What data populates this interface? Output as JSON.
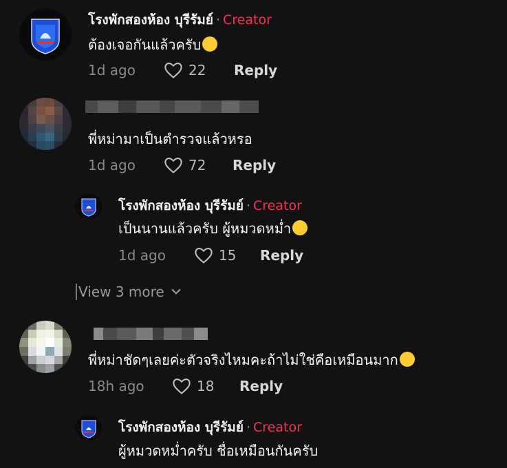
{
  "comments": [
    {
      "username": "โรงพักสองห้อง บุรีรัมย์",
      "separator": "·",
      "badge": "Creator",
      "text": "ต้องเจอกันแล้วครับ",
      "emoji": "laughing-rolling-emoji",
      "time": "1d ago",
      "likes": "22",
      "reply_label": "Reply"
    },
    {
      "username": "",
      "text": "พี่หม่ามาเป็นตำรวจแล้วหรอ",
      "time": "1d ago",
      "likes": "72",
      "reply_label": "Reply"
    },
    {
      "username": "โรงพักสองห้อง บุรีรัมย์",
      "separator": "·",
      "badge": "Creator",
      "text": "เป็นนานแล้วครับ ผู้หมวดหม่ำ",
      "emoji": "laughing-rolling-emoji",
      "time": "1d ago",
      "likes": "15",
      "reply_label": "Reply"
    },
    {
      "username": "",
      "text": "พี่หม่าชัดๆเลยค่ะตัวจริงไหมคะถ้าไม่ใช่คือเหมือนมาก",
      "emoji": "grinning-emoji",
      "time": "18h ago",
      "likes": "18",
      "reply_label": "Reply"
    },
    {
      "username": "โรงพักสองห้อง บุรีรัมย์",
      "separator": "·",
      "badge": "Creator",
      "text": "ผู้หมวดหม่ำครับ ชื่อเหมือนกันครับ"
    }
  ],
  "view_more": {
    "label": "View 3 more"
  },
  "colors": {
    "background": "#121212",
    "creator": "#fe2c55",
    "muted": "#8a8a8a"
  }
}
